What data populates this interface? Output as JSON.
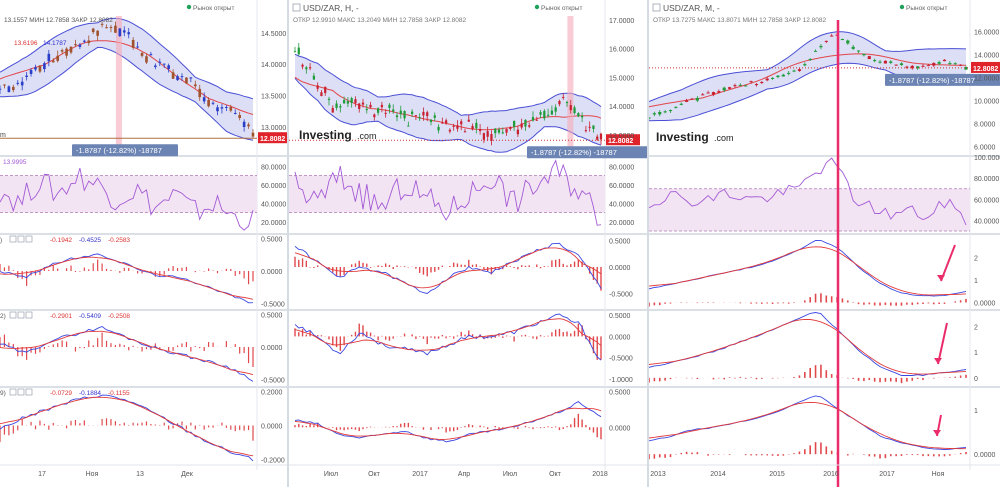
{
  "colors": {
    "band_fill": "#dcdff5",
    "band_line": "#4a4fd6",
    "ma_line": "#e2464a",
    "candle_up": "#2a3fc9",
    "candle_down": "#a0522d",
    "candle_up_h": "#1f9b3a",
    "candle_down_h": "#c9202f",
    "rsi": "#a35ad6",
    "rsi_band": "#f3e4f3",
    "macd": "#3a48e0",
    "signal": "#e23a3a",
    "hist": "#e0484c",
    "highlight": "#ea2d6a",
    "label_box": "#6c84b3",
    "price_tag": "#e0232b",
    "open_dot": "#1fa15a"
  },
  "badge_text": "-1.8787 (-12.82%) -18787",
  "price_tag": "12.8082",
  "market_open": "Рынок открыт",
  "watermark_main": "Investing",
  "watermark_suffix": ".com",
  "charts": {
    "left": {
      "header": {
        "o": "13.1557",
        "mn_label": "МИН",
        "mn": "12.7858",
        "cl_label": "ЗАКР",
        "cl": "12.8082"
      },
      "ma_labels": [
        "13.6196",
        "14.1787"
      ],
      "rsi_value": "13.9995",
      "macd_values": [
        [
          "-0.1942",
          "-0.4525",
          "-0.2583"
        ],
        [
          "-0.2901",
          "-0.5409",
          "-0.2508"
        ],
        [
          "-0.0729",
          "-0.1884",
          "-0.1155"
        ]
      ],
      "price_ticks": [
        "14.5000",
        "14.0000",
        "13.5000",
        "13.0000"
      ],
      "rsi_ticks": [
        "80.0000",
        "60.0000",
        "40.0000",
        "20.0000"
      ],
      "macd_ticks": [
        [
          "0.5000",
          "0.0000",
          "-0.5000"
        ],
        [
          "0.5000",
          "0.0000",
          "-0.5000"
        ],
        [
          "0.2000",
          "0.0000",
          "-0.2000"
        ]
      ],
      "x_ticks": [
        "17",
        "Ноя",
        "13",
        "Дек"
      ],
      "left_clip": "m",
      "rsi_ylim": [
        0,
        100
      ],
      "price_ylim": [
        12.6,
        14.8
      ]
    },
    "mid": {
      "header": {
        "title": "USD/ZAR, Н, -",
        "o_label": "ОТКР",
        "o": "12.9910",
        "mx_label": "МАКС",
        "mx": "13.2049",
        "mn_label": "МИН",
        "mn": "12.7858",
        "cl_label": "ЗАКР",
        "cl": "12.8082"
      },
      "price_ticks": [
        "17.0000",
        "16.0000",
        "15.0000",
        "14.0000",
        "13.0000"
      ],
      "rsi_ticks": [
        "80.0000",
        "60.0000",
        "40.0000",
        "20.0000"
      ],
      "macd_ticks": [
        [
          "0.5000",
          "0.0000",
          "-0.5000"
        ],
        [
          "0.5000",
          "0.0000",
          "-0.5000",
          "-1.0000"
        ],
        [
          "0.5000",
          "0.0000"
        ]
      ],
      "x_ticks": [
        "Июл",
        "Окт",
        "2017",
        "Апр",
        "Июл",
        "Окт",
        "2018"
      ],
      "price_ylim": [
        12.4,
        17.2
      ]
    },
    "right": {
      "header": {
        "title": "USD/ZAR, М, -",
        "o_label": "ОТКР",
        "o": "13.7275",
        "mx_label": "МАКС",
        "mx": "13.8071",
        "mn_label": "МИН",
        "mn": "12.7858",
        "cl_label": "ЗАКР",
        "cl": "12.8082"
      },
      "price_ticks": [
        "16.0000",
        "14.0000",
        "12.0000",
        "10.0000",
        "8.0000",
        "6.0000"
      ],
      "rsi_ticks": [
        "100.0000",
        "80.0000",
        "60.0000",
        "40.0000"
      ],
      "macd_ticks": [
        [
          "2",
          "1",
          "0.0000"
        ],
        [
          "2",
          "1",
          "0"
        ],
        [
          "1",
          "0.0000"
        ]
      ],
      "x_ticks": [
        "2013",
        "2014",
        "2015",
        "2016",
        "2017",
        "Ноя"
      ],
      "price_ylim": [
        5.5,
        17.5
      ]
    }
  }
}
